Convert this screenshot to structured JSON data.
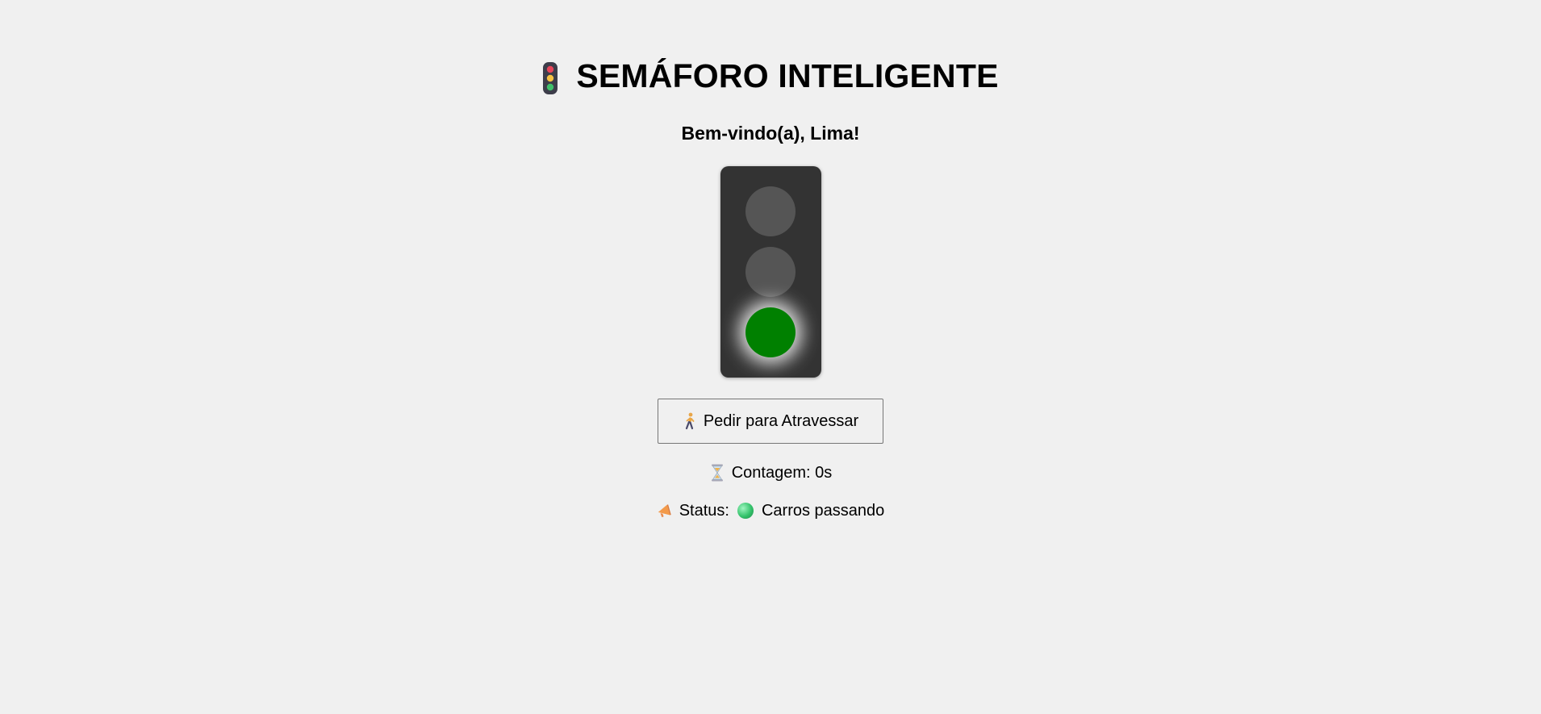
{
  "header": {
    "icon": "traffic-light-icon",
    "title": "SEMÁFORO INTELIGENTE"
  },
  "welcome": {
    "text": "Bem-vindo(a), Lima!"
  },
  "traffic_light": {
    "lamps": [
      {
        "name": "red",
        "active": false,
        "color": "#555555"
      },
      {
        "name": "yellow",
        "active": false,
        "color": "#555555"
      },
      {
        "name": "green",
        "active": true,
        "color": "#008000"
      }
    ],
    "body_color": "#333333"
  },
  "cross_button": {
    "icon": "pedestrian-icon",
    "label": "Pedir para Atravessar"
  },
  "counter": {
    "icon": "hourglass-icon",
    "label": "Contagem: 0s"
  },
  "status": {
    "icon": "megaphone-icon",
    "label": "Status:",
    "indicator_icon": "green-circle-icon",
    "text": "Carros passando"
  },
  "colors": {
    "background": "#f0f0f0",
    "active_green": "#008000",
    "inactive_lamp": "#555555"
  }
}
